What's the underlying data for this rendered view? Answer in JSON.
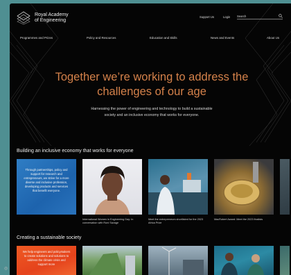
{
  "header": {
    "logo_line1": "Royal Academy",
    "logo_line2": "of Engineering",
    "top_links": [
      "Support Us",
      "Login"
    ],
    "search_label": "Search"
  },
  "nav": [
    "Programmes and Prizes",
    "Policy and Resources",
    "Education and Skills",
    "News and Events",
    "About Us"
  ],
  "hero": {
    "title_line1": "Together we’re working to address the",
    "title_line2": "challenges of our age",
    "subtitle_line1": "Harnessing the power of engineering and technology to build a sustainable",
    "subtitle_line2": "society and an inclusive economy that works for everyone."
  },
  "section1": {
    "heading": "Building an inclusive economy that works for everyone",
    "cards": [
      {
        "overlay": "Through partnerships, policy and support for research and entrepreneurs, we strive for a more diverse and inclusive profession, developing products and services that benefit everyone.",
        "caption": ""
      },
      {
        "overlay": "",
        "caption": "International Women in Engineering Day: In conversation with Roni Savage"
      },
      {
        "overlay": "",
        "caption": "Meet the entrepreneurs shortlisted for the 2023 Africa Prize"
      },
      {
        "overlay": "",
        "caption": "MacRobert Award: Meet the 2023 finalists"
      }
    ]
  },
  "section2": {
    "heading": "Creating a sustainable society",
    "cards": [
      {
        "overlay": "We help engineers and policymakers to create solutions and solutions to address the climate crisis and support more"
      }
    ]
  },
  "colors": {
    "background": "#050505",
    "accent_orange": "#d4814a",
    "page_teal": "#4f8f92"
  }
}
